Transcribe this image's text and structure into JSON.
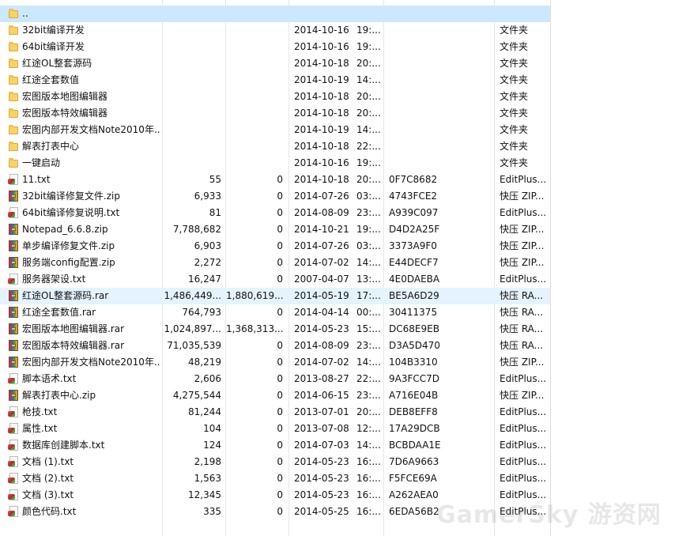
{
  "watermark": "GamerSky 游资网",
  "rows": [
    {
      "icon": "folder-icon",
      "kind": "folder",
      "name": "..",
      "size": "",
      "packed": "",
      "date": "",
      "time": "",
      "crc": "",
      "type": ""
    },
    {
      "icon": "folder-icon",
      "kind": "folder",
      "name": "32bit编译开发",
      "size": "",
      "packed": "",
      "date": "2014-10-16",
      "time": "19:...",
      "crc": "",
      "type": "文件夹"
    },
    {
      "icon": "folder-icon",
      "kind": "folder",
      "name": "64bit编译开发",
      "size": "",
      "packed": "",
      "date": "2014-10-16",
      "time": "19:...",
      "crc": "",
      "type": "文件夹"
    },
    {
      "icon": "folder-icon",
      "kind": "folder",
      "name": "红途OL整套源码",
      "size": "",
      "packed": "",
      "date": "2014-10-18",
      "time": "20:...",
      "crc": "",
      "type": "文件夹"
    },
    {
      "icon": "folder-icon",
      "kind": "folder",
      "name": "红途全套数值",
      "size": "",
      "packed": "",
      "date": "2014-10-19",
      "time": "14:...",
      "crc": "",
      "type": "文件夹"
    },
    {
      "icon": "folder-icon",
      "kind": "folder",
      "name": "宏图版本地图编辑器",
      "size": "",
      "packed": "",
      "date": "2014-10-18",
      "time": "20:...",
      "crc": "",
      "type": "文件夹"
    },
    {
      "icon": "folder-icon",
      "kind": "folder",
      "name": "宏图版本特效编辑器",
      "size": "",
      "packed": "",
      "date": "2014-10-18",
      "time": "20:...",
      "crc": "",
      "type": "文件夹"
    },
    {
      "icon": "folder-icon",
      "kind": "folder",
      "name": "宏图内部开发文档Note2010年...",
      "size": "",
      "packed": "",
      "date": "2014-10-19",
      "time": "14:...",
      "crc": "",
      "type": "文件夹"
    },
    {
      "icon": "folder-icon",
      "kind": "folder",
      "name": "解表打表中心",
      "size": "",
      "packed": "",
      "date": "2014-10-18",
      "time": "22:...",
      "crc": "",
      "type": "文件夹"
    },
    {
      "icon": "folder-icon",
      "kind": "folder",
      "name": "一键启动",
      "size": "",
      "packed": "",
      "date": "2014-10-16",
      "time": "19:...",
      "crc": "",
      "type": "文件夹"
    },
    {
      "icon": "text-file-icon",
      "kind": "txt",
      "name": "11.txt",
      "size": "55",
      "packed": "0",
      "date": "2014-10-18",
      "time": "20:...",
      "crc": "0F7C8682",
      "type": "EditPlus..."
    },
    {
      "icon": "archive-icon",
      "kind": "arc",
      "name": "32bit编译修复文件.zip",
      "size": "6,933",
      "packed": "0",
      "date": "2014-07-26",
      "time": "03:...",
      "crc": "4743FCE2",
      "type": "快压 ZIP..."
    },
    {
      "icon": "text-file-icon",
      "kind": "txt",
      "name": "64bit编译修复说明.txt",
      "size": "81",
      "packed": "0",
      "date": "2014-08-09",
      "time": "23:...",
      "crc": "A939C097",
      "type": "EditPlus..."
    },
    {
      "icon": "archive-icon",
      "kind": "arc",
      "name": "Notepad_6.6.8.zip",
      "size": "7,788,682",
      "packed": "0",
      "date": "2014-10-21",
      "time": "19:...",
      "crc": "D4D2A25F",
      "type": "快压 ZIP..."
    },
    {
      "icon": "archive-icon",
      "kind": "arc",
      "name": "单步编译修复文件.zip",
      "size": "6,903",
      "packed": "0",
      "date": "2014-07-26",
      "time": "03:...",
      "crc": "3373A9F0",
      "type": "快压 ZIP..."
    },
    {
      "icon": "archive-icon",
      "kind": "arc",
      "name": "服务端config配置.zip",
      "size": "2,272",
      "packed": "0",
      "date": "2014-07-02",
      "time": "14:...",
      "crc": "E44DECF7",
      "type": "快压 ZIP..."
    },
    {
      "icon": "text-file-icon",
      "kind": "txt",
      "name": "服务器架设.txt",
      "size": "16,247",
      "packed": "0",
      "date": "2007-04-07",
      "time": "13:...",
      "crc": "4E0DAEBA",
      "type": "EditPlus..."
    },
    {
      "icon": "archive-icon",
      "kind": "arc",
      "name": "红途OL整套源码.rar",
      "size": "1,486,449...",
      "packed": "1,880,619...",
      "date": "2014-05-19",
      "time": "17:...",
      "crc": "BE5A6D29",
      "type": "快压 RA...",
      "state": "hover"
    },
    {
      "icon": "archive-icon",
      "kind": "arc",
      "name": "红途全套数值.rar",
      "size": "764,793",
      "packed": "0",
      "date": "2014-04-14",
      "time": "00:...",
      "crc": "30411375",
      "type": "快压 RA..."
    },
    {
      "icon": "archive-icon",
      "kind": "arc",
      "name": "宏图版本地图编辑器.rar",
      "size": "1,024,897...",
      "packed": "1,368,313...",
      "date": "2014-05-23",
      "time": "15:...",
      "crc": "DC68E9EB",
      "type": "快压 RA..."
    },
    {
      "icon": "archive-icon",
      "kind": "arc",
      "name": "宏图版本特效编辑器.rar",
      "size": "71,035,539",
      "packed": "0",
      "date": "2014-08-09",
      "time": "23:...",
      "crc": "D3A5D470",
      "type": "快压 RA..."
    },
    {
      "icon": "archive-icon",
      "kind": "arc",
      "name": "宏图内部开发文档Note2010年...",
      "size": "48,219",
      "packed": "0",
      "date": "2014-07-02",
      "time": "14:...",
      "crc": "104B3310",
      "type": "快压 ZIP..."
    },
    {
      "icon": "text-file-icon",
      "kind": "txt",
      "name": "脚本语术.txt",
      "size": "2,606",
      "packed": "0",
      "date": "2013-08-27",
      "time": "22:...",
      "crc": "9A3FCC7D",
      "type": "EditPlus..."
    },
    {
      "icon": "archive-icon",
      "kind": "arc",
      "name": "解表打表中心.zip",
      "size": "4,275,544",
      "packed": "0",
      "date": "2014-06-15",
      "time": "23:...",
      "crc": "A716E04B",
      "type": "快压 ZIP..."
    },
    {
      "icon": "text-file-icon",
      "kind": "txt",
      "name": "枪技.txt",
      "size": "81,244",
      "packed": "0",
      "date": "2013-07-01",
      "time": "20:...",
      "crc": "DEB8EFF8",
      "type": "EditPlus..."
    },
    {
      "icon": "text-file-icon",
      "kind": "txt",
      "name": "属性.txt",
      "size": "104",
      "packed": "0",
      "date": "2013-07-08",
      "time": "12:...",
      "crc": "17A29DCB",
      "type": "EditPlus..."
    },
    {
      "icon": "text-file-icon",
      "kind": "txt",
      "name": "数据库创建脚本.txt",
      "size": "124",
      "packed": "0",
      "date": "2014-07-03",
      "time": "14:...",
      "crc": "BCBDAA1E",
      "type": "EditPlus..."
    },
    {
      "icon": "text-file-icon",
      "kind": "txt",
      "name": "文档 (1).txt",
      "size": "2,198",
      "packed": "0",
      "date": "2014-05-23",
      "time": "16:...",
      "crc": "7D6A9663",
      "type": "EditPlus..."
    },
    {
      "icon": "text-file-icon",
      "kind": "txt",
      "name": "文档 (2).txt",
      "size": "1,563",
      "packed": "0",
      "date": "2014-05-23",
      "time": "16:...",
      "crc": "F5FCE69A",
      "type": "EditPlus..."
    },
    {
      "icon": "text-file-icon",
      "kind": "txt",
      "name": "文档 (3).txt",
      "size": "12,345",
      "packed": "0",
      "date": "2014-05-23",
      "time": "16:...",
      "crc": "A262AEA0",
      "type": "EditPlus..."
    },
    {
      "icon": "text-file-icon",
      "kind": "txt",
      "name": "颜色代码.txt",
      "size": "335",
      "packed": "0",
      "date": "2014-05-25",
      "time": "16:...",
      "crc": "6EDA56B2",
      "type": "EditPlus..."
    }
  ],
  "selected_row": 0
}
